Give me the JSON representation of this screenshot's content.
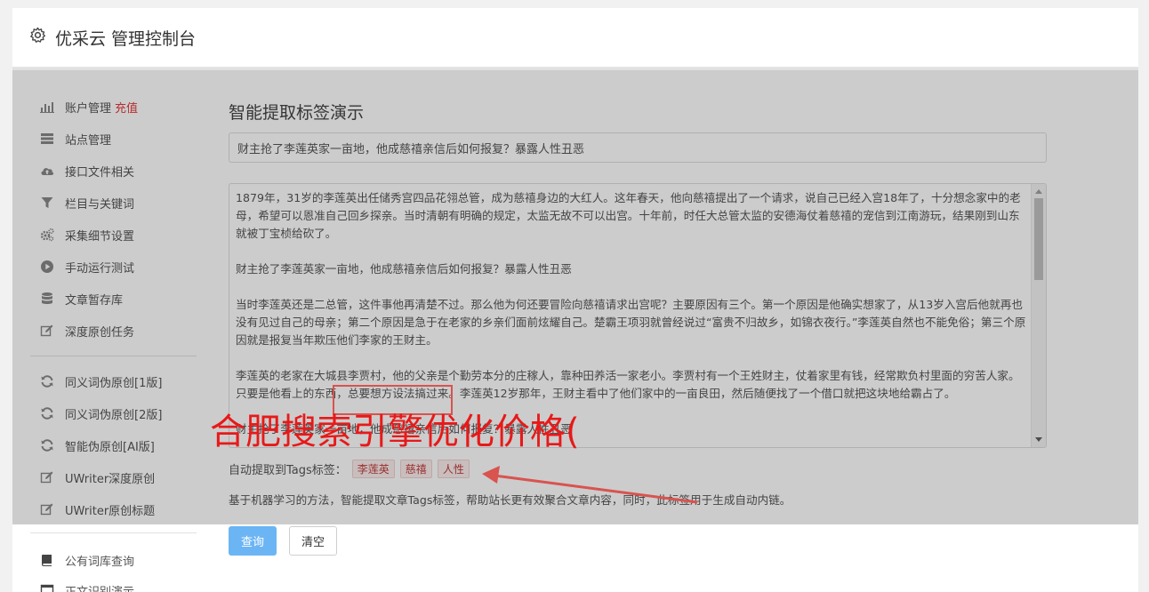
{
  "header": {
    "title": "优采云 管理控制台",
    "icon": "gear-icon"
  },
  "sidebar": {
    "items": [
      {
        "label": "账户管理",
        "badge": "充值",
        "icon": "bar-chart-icon"
      },
      {
        "label": "站点管理",
        "icon": "server-icon"
      },
      {
        "label": "接口文件相关",
        "icon": "cloud-upload-icon"
      },
      {
        "label": "栏目与关键词",
        "icon": "filter-icon"
      },
      {
        "label": "采集细节设置",
        "icon": "cogs-icon"
      },
      {
        "label": "手动运行测试",
        "icon": "play-circle-icon"
      },
      {
        "label": "文章暂存库",
        "icon": "database-icon"
      },
      {
        "label": "深度原创任务",
        "icon": "edit-icon"
      }
    ],
    "items2": [
      {
        "label": "同义词伪原创[1版]",
        "icon": "refresh-icon"
      },
      {
        "label": "同义词伪原创[2版]",
        "icon": "refresh-icon"
      },
      {
        "label": "智能伪原创[AI版]",
        "icon": "refresh-icon"
      },
      {
        "label": "UWriter深度原创",
        "icon": "edit-icon"
      },
      {
        "label": "UWriter原创标题",
        "icon": "edit-icon"
      }
    ],
    "items3": [
      {
        "label": "公有词库查询",
        "icon": "book-icon"
      },
      {
        "label": "正文识别演示",
        "icon": "window-icon"
      }
    ]
  },
  "main": {
    "page_title": "智能提取标签演示",
    "title_input_value": "财主抢了李莲英家一亩地，他成慈禧亲信后如何报复？暴露人性丑恶",
    "content_paragraphs": [
      "1879年，31岁的李莲英出任储秀宫四品花翎总管，成为慈禧身边的大红人。这年春天，他向慈禧提出了一个请求，说自己已经入宫18年了，十分想念家中的老母，希望可以恩准自己回乡探亲。当时清朝有明确的规定，太监无故不可以出宫。十年前，时任大总管太监的安德海仗着慈禧的宠信到江南游玩，结果刚到山东就被丁宝桢给砍了。",
      "财主抢了李莲英家一亩地，他成慈禧亲信后如何报复？暴露人性丑恶",
      "当时李莲英还是二总管，这件事他再清楚不过。那么他为何还要冒险向慈禧请求出宫呢？主要原因有三个。第一个原因是他确实想家了，从13岁入宫后他就再也没有见过自己的母亲；第二个原因是急于在老家的乡亲们面前炫耀自己。楚霸王项羽就曾经说过“富贵不归故乡，如锦衣夜行。”李莲英自然也不能免俗；第三个原因就是报复当年欺压他们李家的王财主。",
      "李莲英的老家在大城县李贾村，他的父亲是个勤劳本分的庄稼人，靠种田养活一家老小。李贾村有一个王姓财主，仗着家里有钱，经常欺负村里面的穷苦人家。只要是他看上的东西，总要想方设法搞过来。李莲英12岁那年，王财主看中了他们家中的一亩良田，然后随便找了一个借口就把这块地给霸占了。",
      "财主抢了李莲英家一亩地，他成慈禧亲信后如何报复？暴露人性丑恶"
    ],
    "tags_label": "自动提取到Tags标签：",
    "tags": [
      "李莲英",
      "慈禧",
      "人性"
    ],
    "description": "基于机器学习的方法，智能提取文章Tags标签，帮助站长更有效聚合文章内容，同时，此标签用于生成自动内链。",
    "query_button": "查询",
    "clear_button": "清空"
  },
  "watermark": "合肥搜索引擎优化价格(",
  "colors": {
    "accent_button": "#6cb5f4",
    "badge_red": "#e4393c",
    "watermark_red": "#e81919",
    "highlight_box": "#d9534f"
  }
}
